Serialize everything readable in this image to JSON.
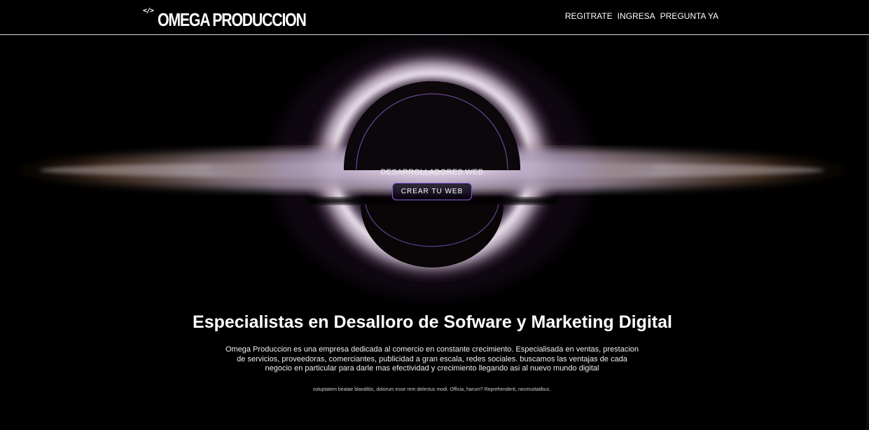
{
  "header": {
    "logo_icon": "</>",
    "logo_text": "OMEGA PRODUCCION",
    "nav": [
      {
        "label": "REGITRATE"
      },
      {
        "label": "INGRESA"
      },
      {
        "label": "PREGUNTA YA"
      }
    ]
  },
  "hero": {
    "subtitle": "DESARROLLADORES WEB",
    "cta_label": "CREAR TU WEB"
  },
  "main": {
    "headline": "Especialistas en Desalloro de Sofware y Marketing Digital",
    "description": "Omega Produccion es una empresa dedicada al comercio en constante crecimiento. Especialisada en ventas, prestacion de servicios, proveedoras, comerciantes, publicidad a gran escala, redes sociales. buscamos las ventajas de cada negocio en particular para darle mas efectividad y crecimiento llegando asi al nuevo mundo digital",
    "footnote": "voluptatem beatae blanditiis, dolorum esse rem delectus modi. Officia, harum? Reprehenderit, necessitatibus."
  },
  "colors": {
    "background": "#000000",
    "accent": "#8b5fd6",
    "text": "#ffffff"
  }
}
